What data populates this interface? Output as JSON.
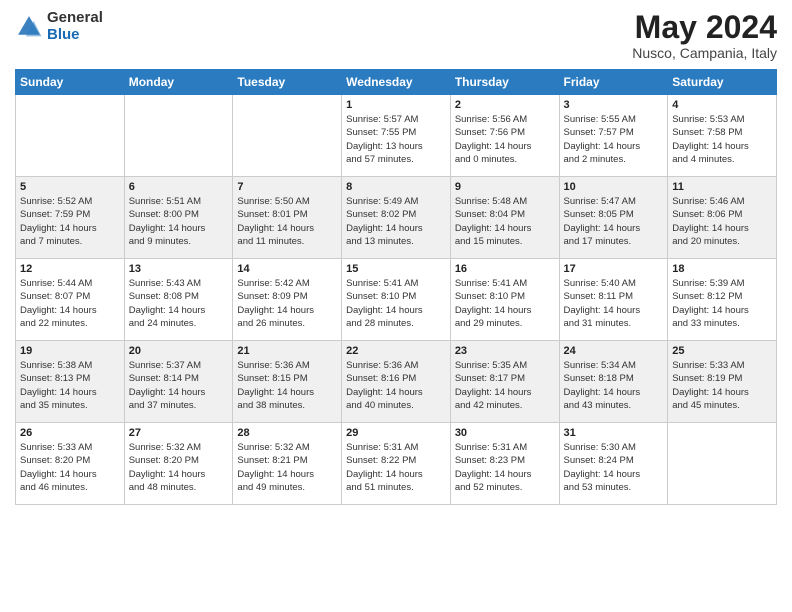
{
  "logo": {
    "general": "General",
    "blue": "Blue"
  },
  "title": {
    "month": "May 2024",
    "location": "Nusco, Campania, Italy"
  },
  "weekdays": [
    "Sunday",
    "Monday",
    "Tuesday",
    "Wednesday",
    "Thursday",
    "Friday",
    "Saturday"
  ],
  "weeks": [
    [
      {
        "day": "",
        "info": ""
      },
      {
        "day": "",
        "info": ""
      },
      {
        "day": "",
        "info": ""
      },
      {
        "day": "1",
        "info": "Sunrise: 5:57 AM\nSunset: 7:55 PM\nDaylight: 13 hours\nand 57 minutes."
      },
      {
        "day": "2",
        "info": "Sunrise: 5:56 AM\nSunset: 7:56 PM\nDaylight: 14 hours\nand 0 minutes."
      },
      {
        "day": "3",
        "info": "Sunrise: 5:55 AM\nSunset: 7:57 PM\nDaylight: 14 hours\nand 2 minutes."
      },
      {
        "day": "4",
        "info": "Sunrise: 5:53 AM\nSunset: 7:58 PM\nDaylight: 14 hours\nand 4 minutes."
      }
    ],
    [
      {
        "day": "5",
        "info": "Sunrise: 5:52 AM\nSunset: 7:59 PM\nDaylight: 14 hours\nand 7 minutes."
      },
      {
        "day": "6",
        "info": "Sunrise: 5:51 AM\nSunset: 8:00 PM\nDaylight: 14 hours\nand 9 minutes."
      },
      {
        "day": "7",
        "info": "Sunrise: 5:50 AM\nSunset: 8:01 PM\nDaylight: 14 hours\nand 11 minutes."
      },
      {
        "day": "8",
        "info": "Sunrise: 5:49 AM\nSunset: 8:02 PM\nDaylight: 14 hours\nand 13 minutes."
      },
      {
        "day": "9",
        "info": "Sunrise: 5:48 AM\nSunset: 8:04 PM\nDaylight: 14 hours\nand 15 minutes."
      },
      {
        "day": "10",
        "info": "Sunrise: 5:47 AM\nSunset: 8:05 PM\nDaylight: 14 hours\nand 17 minutes."
      },
      {
        "day": "11",
        "info": "Sunrise: 5:46 AM\nSunset: 8:06 PM\nDaylight: 14 hours\nand 20 minutes."
      }
    ],
    [
      {
        "day": "12",
        "info": "Sunrise: 5:44 AM\nSunset: 8:07 PM\nDaylight: 14 hours\nand 22 minutes."
      },
      {
        "day": "13",
        "info": "Sunrise: 5:43 AM\nSunset: 8:08 PM\nDaylight: 14 hours\nand 24 minutes."
      },
      {
        "day": "14",
        "info": "Sunrise: 5:42 AM\nSunset: 8:09 PM\nDaylight: 14 hours\nand 26 minutes."
      },
      {
        "day": "15",
        "info": "Sunrise: 5:41 AM\nSunset: 8:10 PM\nDaylight: 14 hours\nand 28 minutes."
      },
      {
        "day": "16",
        "info": "Sunrise: 5:41 AM\nSunset: 8:10 PM\nDaylight: 14 hours\nand 29 minutes."
      },
      {
        "day": "17",
        "info": "Sunrise: 5:40 AM\nSunset: 8:11 PM\nDaylight: 14 hours\nand 31 minutes."
      },
      {
        "day": "18",
        "info": "Sunrise: 5:39 AM\nSunset: 8:12 PM\nDaylight: 14 hours\nand 33 minutes."
      }
    ],
    [
      {
        "day": "19",
        "info": "Sunrise: 5:38 AM\nSunset: 8:13 PM\nDaylight: 14 hours\nand 35 minutes."
      },
      {
        "day": "20",
        "info": "Sunrise: 5:37 AM\nSunset: 8:14 PM\nDaylight: 14 hours\nand 37 minutes."
      },
      {
        "day": "21",
        "info": "Sunrise: 5:36 AM\nSunset: 8:15 PM\nDaylight: 14 hours\nand 38 minutes."
      },
      {
        "day": "22",
        "info": "Sunrise: 5:36 AM\nSunset: 8:16 PM\nDaylight: 14 hours\nand 40 minutes."
      },
      {
        "day": "23",
        "info": "Sunrise: 5:35 AM\nSunset: 8:17 PM\nDaylight: 14 hours\nand 42 minutes."
      },
      {
        "day": "24",
        "info": "Sunrise: 5:34 AM\nSunset: 8:18 PM\nDaylight: 14 hours\nand 43 minutes."
      },
      {
        "day": "25",
        "info": "Sunrise: 5:33 AM\nSunset: 8:19 PM\nDaylight: 14 hours\nand 45 minutes."
      }
    ],
    [
      {
        "day": "26",
        "info": "Sunrise: 5:33 AM\nSunset: 8:20 PM\nDaylight: 14 hours\nand 46 minutes."
      },
      {
        "day": "27",
        "info": "Sunrise: 5:32 AM\nSunset: 8:20 PM\nDaylight: 14 hours\nand 48 minutes."
      },
      {
        "day": "28",
        "info": "Sunrise: 5:32 AM\nSunset: 8:21 PM\nDaylight: 14 hours\nand 49 minutes."
      },
      {
        "day": "29",
        "info": "Sunrise: 5:31 AM\nSunset: 8:22 PM\nDaylight: 14 hours\nand 51 minutes."
      },
      {
        "day": "30",
        "info": "Sunrise: 5:31 AM\nSunset: 8:23 PM\nDaylight: 14 hours\nand 52 minutes."
      },
      {
        "day": "31",
        "info": "Sunrise: 5:30 AM\nSunset: 8:24 PM\nDaylight: 14 hours\nand 53 minutes."
      },
      {
        "day": "",
        "info": ""
      }
    ]
  ]
}
